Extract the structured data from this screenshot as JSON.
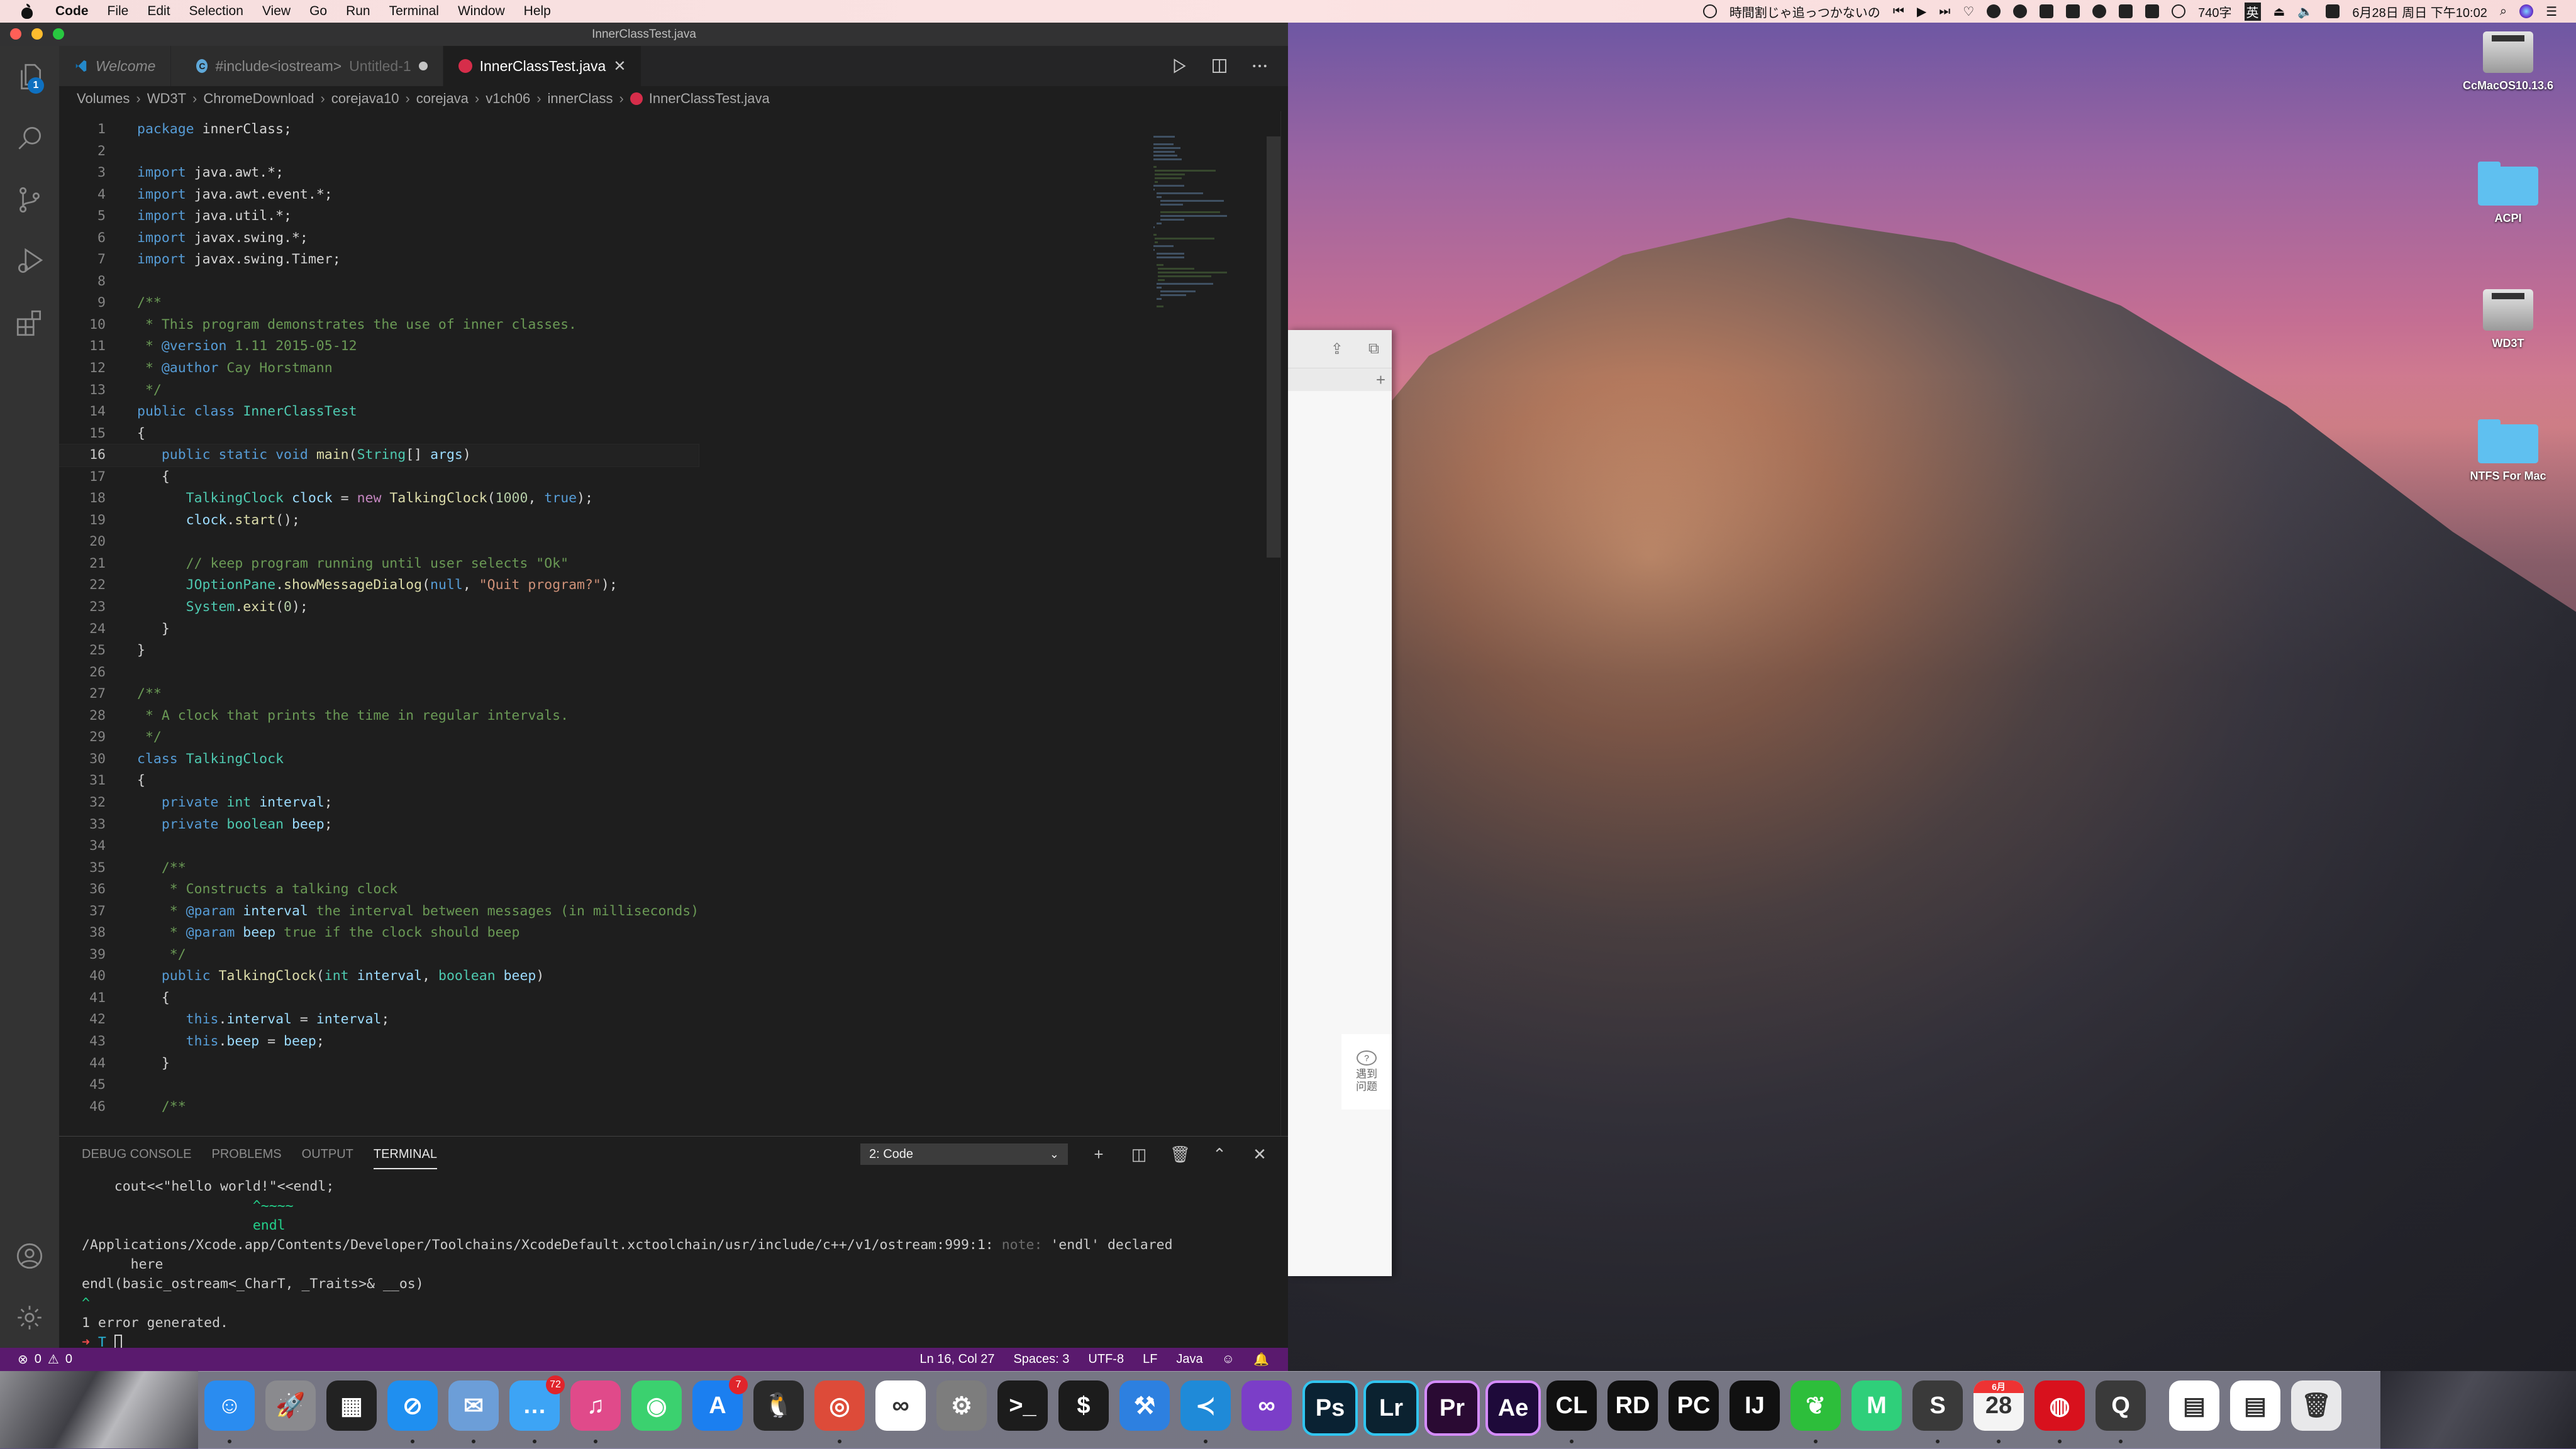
{
  "menubar": {
    "app": "Code",
    "items": [
      "File",
      "Edit",
      "Selection",
      "View",
      "Go",
      "Run",
      "Terminal",
      "Window",
      "Help"
    ],
    "now_playing": "時間割じゃ追っつかないの",
    "word_count": "740字",
    "input_method": "英",
    "datetime": "6月28日 周日 下午10:02"
  },
  "window": {
    "title": "InnerClassTest.java",
    "explorer_badge": "1"
  },
  "tabs": [
    {
      "label": "Welcome",
      "icon": "vscode-icon",
      "active": false
    },
    {
      "label": "#include<iostream>",
      "sublabel": "Untitled-1",
      "icon": "cpp-icon",
      "dirty": true,
      "active": false
    },
    {
      "label": "InnerClassTest.java",
      "icon": "java-icon",
      "active": true,
      "close": "✕"
    }
  ],
  "breadcrumb": [
    "Volumes",
    "WD3T",
    "ChromeDownload",
    "corejava10",
    "corejava",
    "v1ch06",
    "innerClass",
    "InnerClassTest.java"
  ],
  "editor": {
    "language": "java",
    "current_line": 16,
    "lines": [
      "package innerClass;",
      "",
      "import java.awt.*;",
      "import java.awt.event.*;",
      "import java.util.*;",
      "import javax.swing.*;",
      "import javax.swing.Timer;",
      "",
      "/**",
      " * This program demonstrates the use of inner classes.",
      " * @version 1.11 2015-05-12",
      " * @author Cay Horstmann",
      " */",
      "public class InnerClassTest",
      "{",
      "   public static void main(String[] args)",
      "   {",
      "      TalkingClock clock = new TalkingClock(1000, true);",
      "      clock.start();",
      "",
      "      // keep program running until user selects \"Ok\"",
      "      JOptionPane.showMessageDialog(null, \"Quit program?\");",
      "      System.exit(0);",
      "   }",
      "}",
      "",
      "/**",
      " * A clock that prints the time in regular intervals.",
      " */",
      "class TalkingClock",
      "{",
      "   private int interval;",
      "   private boolean beep;",
      "",
      "   /**",
      "    * Constructs a talking clock",
      "    * @param interval the interval between messages (in milliseconds)",
      "    * @param beep true if the clock should beep",
      "    */",
      "   public TalkingClock(int interval, boolean beep)",
      "   {",
      "      this.interval = interval;",
      "      this.beep = beep;",
      "   }",
      "",
      "   /**"
    ]
  },
  "panel": {
    "tabs": [
      "DEBUG CONSOLE",
      "PROBLEMS",
      "OUTPUT",
      "TERMINAL"
    ],
    "active_tab": "TERMINAL",
    "terminal_select": "2: Code",
    "terminal_lines": [
      {
        "text": "    cout<<\"hello world!\"<<endl;",
        "cls": ""
      },
      {
        "text": "                     ^~~~~",
        "cls": "g"
      },
      {
        "text": "                     endl",
        "cls": "g"
      },
      {
        "text": "/Applications/Xcode.app/Contents/Developer/Toolchains/XcodeDefault.xctoolchain/usr/include/c++/v1/ostream:999:1: ",
        "cls": "",
        "note": "note:",
        "after": " 'endl' declared"
      },
      {
        "text": "      here",
        "cls": ""
      },
      {
        "text": "endl(basic_ostream<_CharT, _Traits>& __os)",
        "cls": ""
      },
      {
        "text": "^",
        "cls": "g"
      },
      {
        "text": "1 error generated.",
        "cls": ""
      }
    ],
    "prompt_arrow": "➜",
    "prompt_dir": "T"
  },
  "status": {
    "errors": "0",
    "warnings": "0",
    "position": "Ln 16, Col 27",
    "spaces": "Spaces: 3",
    "encoding": "UTF-8",
    "eol": "LF",
    "language": "Java"
  },
  "side_window": {
    "help_label": "遇到问题"
  },
  "desktop_icons": [
    {
      "label": "CcMacOS10.13.6",
      "kind": "drive"
    },
    {
      "label": "ACPI",
      "kind": "folder"
    },
    {
      "label": "WD3T",
      "kind": "drive"
    },
    {
      "label": "NTFS For Mac",
      "kind": "folder"
    }
  ],
  "dock": [
    {
      "name": "Finder",
      "glyph": "☺",
      "color": "#2a8cf0",
      "running": true
    },
    {
      "name": "Launchpad",
      "glyph": "🚀",
      "color": "#8a8a8e",
      "running": false
    },
    {
      "name": "Mission Control",
      "glyph": "▦",
      "color": "#222222",
      "running": false
    },
    {
      "name": "Safari",
      "glyph": "⊘",
      "color": "#1f8ff0",
      "running": true
    },
    {
      "name": "Preview",
      "glyph": "✉",
      "color": "#6c9ed8",
      "running": true
    },
    {
      "name": "Messages",
      "glyph": "…",
      "color": "#3da4f5",
      "running": true,
      "badge": "72"
    },
    {
      "name": "iTunes",
      "glyph": "♫",
      "color": "#e04a8a",
      "running": true
    },
    {
      "name": "WeChat",
      "glyph": "◉",
      "color": "#3bd16f",
      "running": false
    },
    {
      "name": "App Store",
      "glyph": "A",
      "color": "#1b7ff0",
      "running": false,
      "badge": "7"
    },
    {
      "name": "QQ",
      "glyph": "🐧",
      "color": "#2a2a2a",
      "running": false
    },
    {
      "name": "Chrome",
      "glyph": "◎",
      "color": "#dd4b39",
      "running": true
    },
    {
      "name": "Baidu Netdisk",
      "glyph": "∞",
      "color": "#ffffff",
      "running": false
    },
    {
      "name": "System Preferences",
      "glyph": "⚙",
      "color": "#7d7d7d",
      "running": false
    },
    {
      "name": "Terminal",
      "glyph": ">_",
      "color": "#1c1c1c",
      "running": false
    },
    {
      "name": "iTerm",
      "glyph": "$",
      "color": "#1c1c1c",
      "running": false
    },
    {
      "name": "Xcode",
      "glyph": "⚒",
      "color": "#2d80e0",
      "running": false
    },
    {
      "name": "Visual Studio Code",
      "glyph": "≺",
      "color": "#1f8ad8",
      "running": true
    },
    {
      "name": "Visual Studio",
      "glyph": "∞",
      "color": "#7b3ec8",
      "running": false
    },
    {
      "name": "Photoshop",
      "glyph": "Ps",
      "color": "#0a2233",
      "running": false
    },
    {
      "name": "Lightroom",
      "glyph": "Lr",
      "color": "#0b2230",
      "running": false
    },
    {
      "name": "Premiere Pro",
      "glyph": "Pr",
      "color": "#2a0a33",
      "running": false
    },
    {
      "name": "After Effects",
      "glyph": "Ae",
      "color": "#1e0a3a",
      "running": false
    },
    {
      "name": "CLion",
      "glyph": "CL",
      "color": "#111111",
      "running": true
    },
    {
      "name": "Rider",
      "glyph": "RD",
      "color": "#111111",
      "running": false
    },
    {
      "name": "PyCharm",
      "glyph": "PC",
      "color": "#111111",
      "running": false
    },
    {
      "name": "IntelliJ IDEA",
      "glyph": "IJ",
      "color": "#111111",
      "running": false
    },
    {
      "name": "Evernote",
      "glyph": "❦",
      "color": "#2dbe3b",
      "running": true
    },
    {
      "name": "MindNode",
      "glyph": "M",
      "color": "#2fcf7a",
      "running": false
    },
    {
      "name": "Sublime Text",
      "glyph": "S",
      "color": "#3a3a3a",
      "running": true
    },
    {
      "name": "Calendar",
      "glyph": "28",
      "color": "#f4f4f4",
      "running": true,
      "month": "6月"
    },
    {
      "name": "NetEase Music",
      "glyph": "◍",
      "color": "#d8111d",
      "running": true
    },
    {
      "name": "QuickTime Player",
      "glyph": "Q",
      "color": "#3a3a3a",
      "running": true
    },
    {
      "name": "Recent Document 1",
      "glyph": "▤",
      "color": "#ffffff",
      "running": false
    },
    {
      "name": "Recent Document 2",
      "glyph": "▤",
      "color": "#ffffff",
      "running": false
    },
    {
      "name": "Trash",
      "glyph": "🗑",
      "color": "#e8e8ea",
      "running": false
    }
  ]
}
